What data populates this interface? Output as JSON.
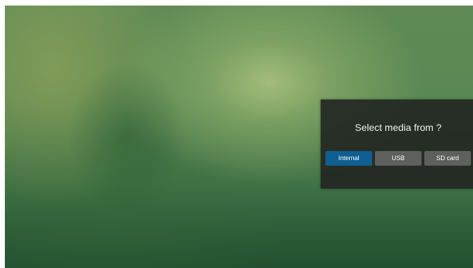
{
  "dialog": {
    "title": "Select media from ?",
    "options": [
      {
        "label": "Internal",
        "selected": true
      },
      {
        "label": "USB",
        "selected": false
      },
      {
        "label": "SD card",
        "selected": false
      }
    ]
  },
  "colors": {
    "selected_button": "#0f5f93",
    "button": "#5d605d",
    "dialog_background": "#212521"
  }
}
